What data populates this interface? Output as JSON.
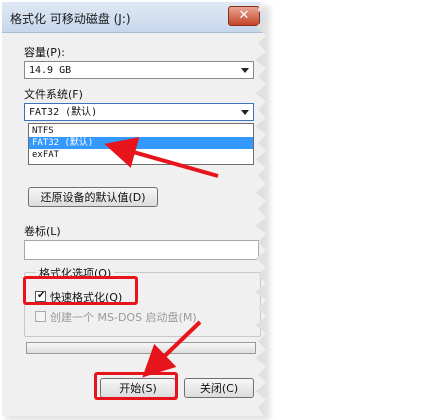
{
  "window": {
    "title": "格式化 可移动磁盘 (J:)",
    "close_glyph": "✕"
  },
  "capacity": {
    "label": "容量(P):",
    "value": "14.9 GB"
  },
  "filesystem": {
    "label": "文件系统(F)",
    "value": "FAT32 (默认)",
    "options": [
      "NTFS",
      "FAT32 (默认)",
      "exFAT"
    ],
    "selected_index": 1
  },
  "restore_button": "还原设备的默认值(D)",
  "volume_label": {
    "label": "卷标(L)",
    "value": ""
  },
  "format_options": {
    "group_label": "格式化选项(O)",
    "quick_format": {
      "label": "快速格式化(Q)",
      "checked": true
    },
    "msdos_startup": {
      "label": "创建一个 MS-DOS 启动盘(M)",
      "checked": false,
      "disabled": true
    }
  },
  "buttons": {
    "start": "开始(S)",
    "close": "关闭(C)"
  },
  "colors": {
    "annotation_red": "#e8141c",
    "selection_blue": "#3399ff"
  }
}
